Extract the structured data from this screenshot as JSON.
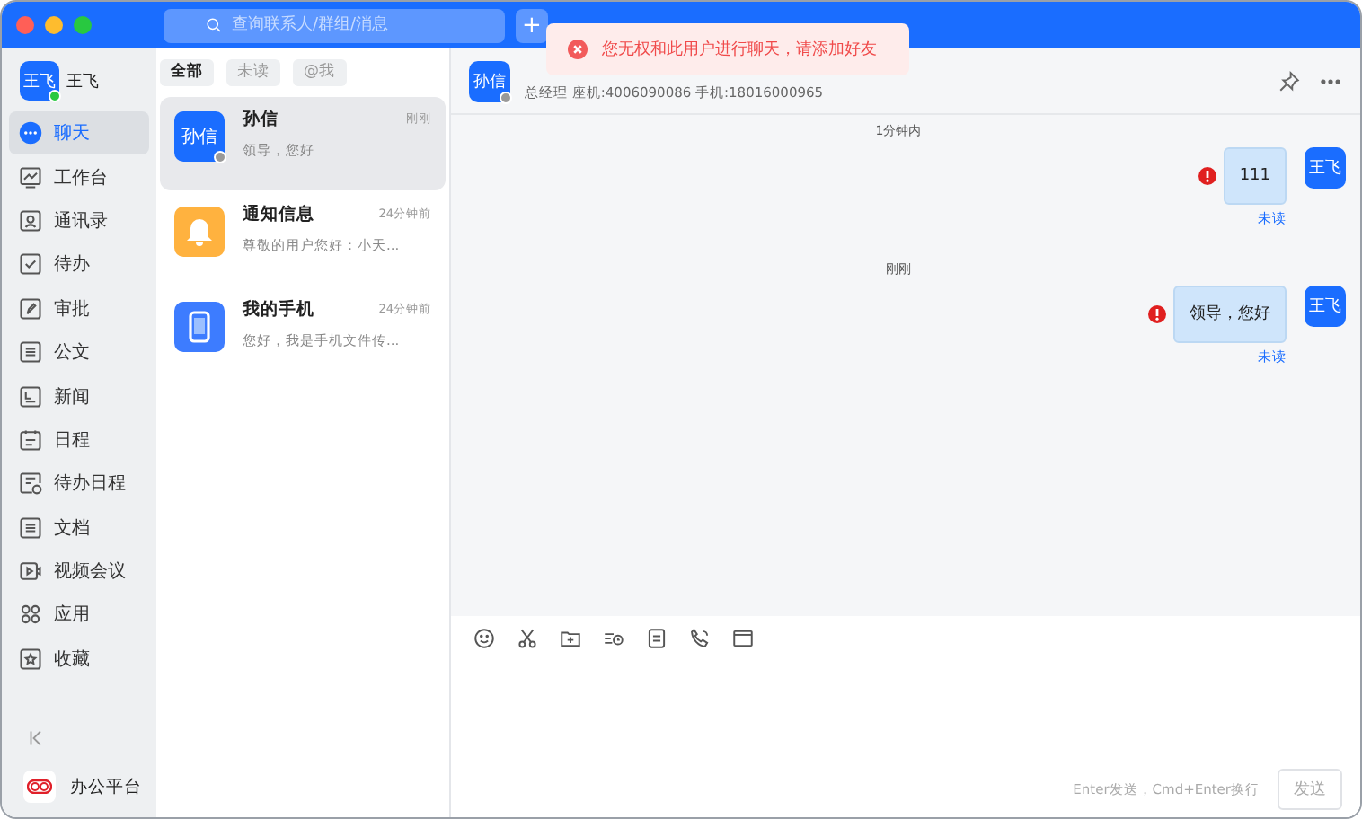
{
  "title_bar": {
    "search": {
      "placeholder": "查询联系人/群组/消息"
    },
    "add_button": "+"
  },
  "user": {
    "avatar": "王飞",
    "name": "王飞",
    "online": true
  },
  "nav": [
    {
      "label": "聊天",
      "selected": true
    },
    {
      "label": "工作台",
      "selected": false
    },
    {
      "label": "通讯录",
      "selected": false
    },
    {
      "label": "待办",
      "selected": false
    },
    {
      "label": "审批",
      "selected": false
    },
    {
      "label": "公文",
      "selected": false
    },
    {
      "label": "新闻",
      "selected": false
    },
    {
      "label": "日程",
      "selected": false
    },
    {
      "label": "待办日程",
      "selected": false
    },
    {
      "label": "文档",
      "selected": false
    },
    {
      "label": "视频会议",
      "selected": false
    },
    {
      "label": "应用",
      "selected": false
    },
    {
      "label": "收藏",
      "selected": false
    }
  ],
  "sidebar_footer": {
    "app_name": "办公平台"
  },
  "filters": [
    {
      "label": "全部",
      "selected": true
    },
    {
      "label": "未读",
      "selected": false
    },
    {
      "label": "@我",
      "selected": false
    }
  ],
  "conversations": [
    {
      "kind": "person",
      "avatar": "孙信",
      "name": "孙信",
      "time": "刚刚",
      "preview": "领导，您好",
      "selected": true
    },
    {
      "kind": "bell",
      "name": "通知信息",
      "time": "24分钟前",
      "preview": "尊敬的用户您好：小天...",
      "selected": false
    },
    {
      "kind": "phone",
      "name": "我的手机",
      "time": "24分钟前",
      "preview": "您好，我是手机文件传...",
      "selected": false
    }
  ],
  "chat": {
    "avatar": "孙信",
    "info": "总经理 座机:4006090086 手机:18016000965",
    "groups": [
      {
        "time": "1分钟内",
        "messages": [
          {
            "avatar": "王飞",
            "text": "111",
            "failed": true,
            "status": "未读"
          }
        ]
      },
      {
        "time": "刚刚",
        "messages": [
          {
            "avatar": "王飞",
            "text": "领导，您好",
            "failed": true,
            "status": "未读"
          }
        ]
      }
    ],
    "hint": "Enter发送，Cmd+Enter换行",
    "send_button": "发送"
  },
  "toast": {
    "kind": "error",
    "text": "您无权和此用户进行聊天，请添加好友"
  }
}
